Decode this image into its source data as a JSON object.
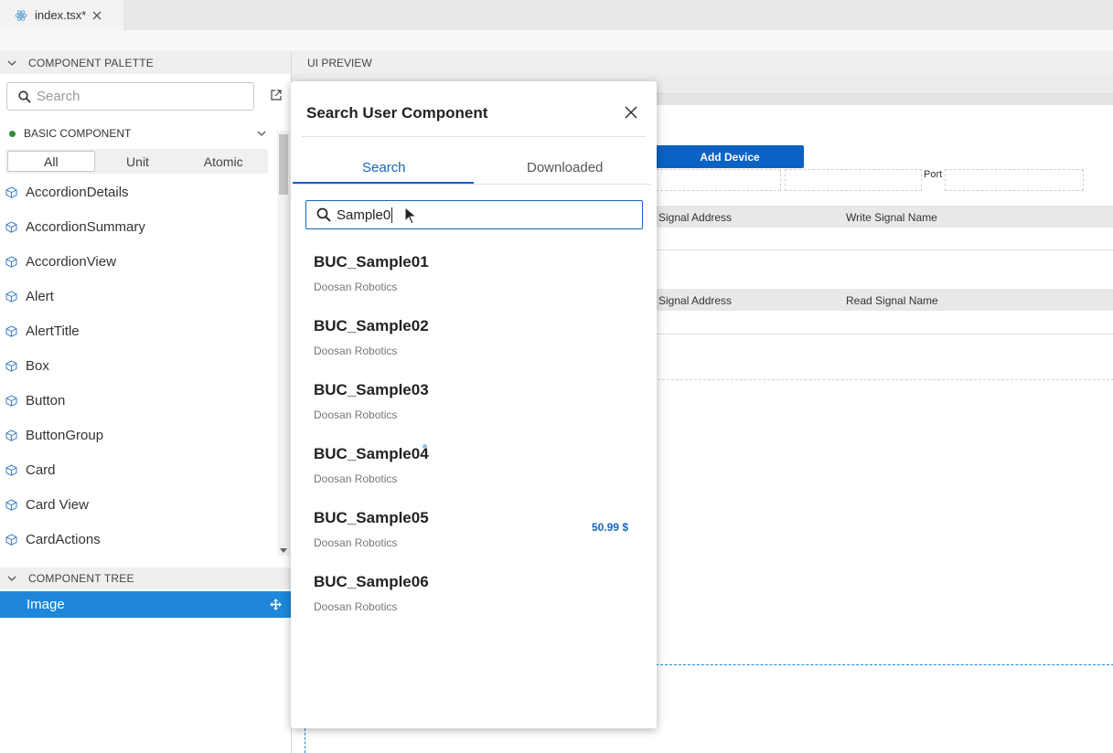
{
  "editor": {
    "tab_label": "index.tsx*"
  },
  "palette": {
    "header": "COMPONENT PALETTE",
    "search_placeholder": "Search",
    "category": "BASIC COMPONENT",
    "filters": [
      "All",
      "Unit",
      "Atomic"
    ],
    "items": [
      "AccordionDetails",
      "AccordionSummary",
      "AccordionView",
      "Alert",
      "AlertTitle",
      "Box",
      "Button",
      "ButtonGroup",
      "Card",
      "Card View",
      "CardActions"
    ]
  },
  "tree": {
    "header": "COMPONENT TREE",
    "selected": "Image"
  },
  "preview": {
    "header": "UI PREVIEW",
    "add_device": "Add Device",
    "port_label": "Port",
    "write_table": {
      "col_address": "Signal Address",
      "col_name": "Write Signal Name"
    },
    "read_table": {
      "col_address": "Signal Address",
      "col_name": "Read Signal Name"
    }
  },
  "modal": {
    "title": "Search User Component",
    "tabs": [
      "Search",
      "Downloaded"
    ],
    "search_value": "Sample0",
    "results": [
      {
        "name": "BUC_Sample01",
        "vendor": "Doosan Robotics",
        "price": ""
      },
      {
        "name": "BUC_Sample02",
        "vendor": "Doosan Robotics",
        "price": ""
      },
      {
        "name": "BUC_Sample03",
        "vendor": "Doosan Robotics",
        "price": ""
      },
      {
        "name": "BUC_Sample04",
        "vendor": "Doosan Robotics",
        "price": ""
      },
      {
        "name": "BUC_Sample05",
        "vendor": "Doosan Robotics",
        "price": "50.99 $"
      },
      {
        "name": "BUC_Sample06",
        "vendor": "Doosan Robotics",
        "price": ""
      }
    ]
  },
  "colors": {
    "accent": "#1565c0",
    "selection": "#1f87d9",
    "button": "#0b62c4",
    "status_dot": "#2e8b3e"
  }
}
